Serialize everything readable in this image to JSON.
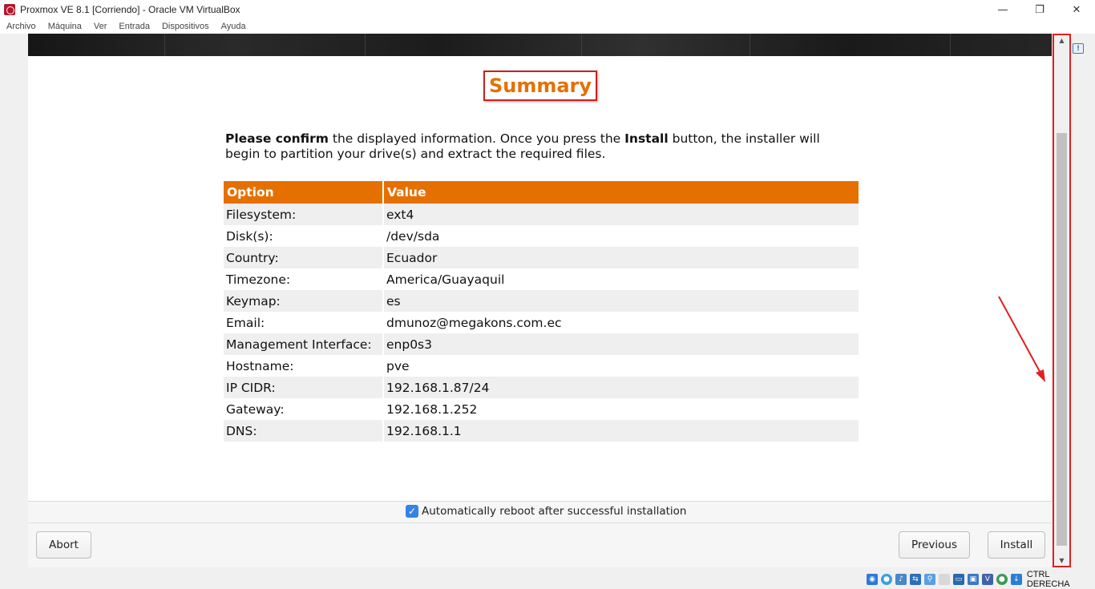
{
  "window": {
    "title": "Proxmox VE 8.1 [Corriendo] - Oracle VM VirtualBox",
    "minimize": "—",
    "maximize": "❐",
    "close": "✕"
  },
  "menu": [
    "Archivo",
    "Máquina",
    "Ver",
    "Entrada",
    "Dispositivos",
    "Ayuda"
  ],
  "installer": {
    "heading": "Summary",
    "intro": {
      "part1_bold": "Please confirm",
      "part2": " the displayed information. Once you press the ",
      "part3_bold": "Install",
      "part4": " button, the installer will begin to partition your drive(s) and extract the required files."
    },
    "table": {
      "header_option": "Option",
      "header_value": "Value",
      "rows": [
        {
          "option": "Filesystem:",
          "value": "ext4"
        },
        {
          "option": "Disk(s):",
          "value": "/dev/sda"
        },
        {
          "option": "Country:",
          "value": "Ecuador"
        },
        {
          "option": "Timezone:",
          "value": "America/Guayaquil"
        },
        {
          "option": "Keymap:",
          "value": "es"
        },
        {
          "option": "Email:",
          "value": "dmunoz@megakons.com.ec"
        },
        {
          "option": "Management Interface:",
          "value": "enp0s3"
        },
        {
          "option": "Hostname:",
          "value": "pve"
        },
        {
          "option": "IP CIDR:",
          "value": "192.168.1.87/24"
        },
        {
          "option": "Gateway:",
          "value": "192.168.1.252"
        },
        {
          "option": "DNS:",
          "value": "192.168.1.1"
        }
      ]
    },
    "auto_reboot": {
      "checked": true,
      "label": "Automatically reboot after successful installation"
    },
    "buttons": {
      "abort": "Abort",
      "previous": "Previous",
      "install": "Install"
    }
  },
  "statusbar": {
    "host_key": "CTRL DERECHA"
  },
  "colors": {
    "accent": "#e57000",
    "annotation": "#e02020",
    "checkbox": "#3584e4"
  }
}
